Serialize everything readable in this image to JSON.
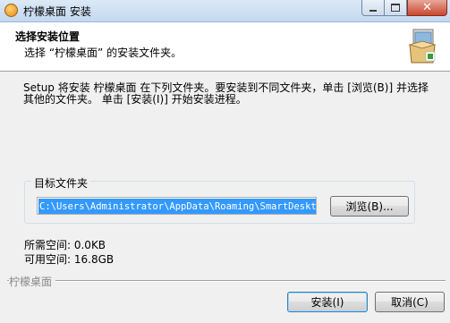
{
  "window": {
    "title": "柠檬桌面 安装"
  },
  "header": {
    "title": "选择安装位置",
    "subtitle": "选择 “柠檬桌面” 的安装文件夹。"
  },
  "description": "Setup 将安装 柠檬桌面 在下列文件夹。要安装到不同文件夹，单击 [浏览(B)] 并选择其他的文件夹。 单击 [安装(I)] 开始安装进程。",
  "destination": {
    "legend": "目标文件夹",
    "path": "C:\\Users\\Administrator\\AppData\\Roaming\\SmartDesktop",
    "browse_label": "浏览(B)..."
  },
  "space": {
    "required": "所需空间: 0.0KB",
    "available": "可用空间: 16.8GB"
  },
  "footer": {
    "brand": "柠檬桌面",
    "install_label": "安装(I)",
    "cancel_label": "取消(C)"
  },
  "icons": {
    "app": "lemon-app-icon",
    "header": "installer-box-icon"
  },
  "colors": {
    "selection": "#3399ff",
    "titlebar": "#c3d8ef",
    "close_button": "#c9472f"
  }
}
